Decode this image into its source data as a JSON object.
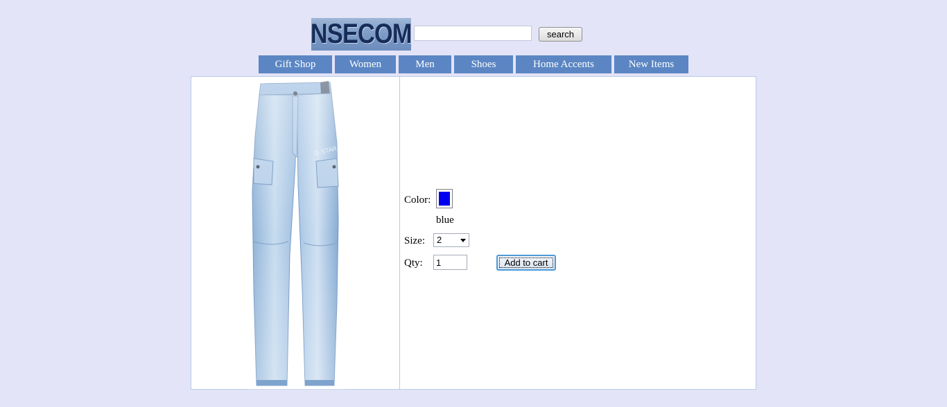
{
  "header": {
    "logo_text": "NSECOM",
    "search_value": "",
    "search_button_label": "search"
  },
  "nav": {
    "items": [
      {
        "label": "Gift Shop"
      },
      {
        "label": "Women"
      },
      {
        "label": "Men"
      },
      {
        "label": "Shoes"
      },
      {
        "label": "Home Accents"
      },
      {
        "label": "New Items"
      }
    ]
  },
  "product": {
    "image_icon": "jeans-image",
    "color_label": "Color:",
    "color_name": "blue",
    "color_value": "#0000ee",
    "size_label": "Size:",
    "size_selected": "2",
    "qty_label": "Qty:",
    "qty_value": "1",
    "add_to_cart_label": "Add to cart"
  },
  "colors": {
    "background": "#e3e4f8",
    "nav_background": "#5b86c3",
    "border": "#b8cbe6"
  }
}
